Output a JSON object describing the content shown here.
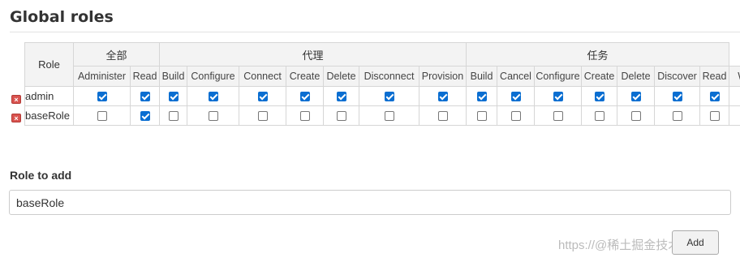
{
  "page": {
    "title": "Global roles"
  },
  "grid": {
    "role_header": "Role",
    "groups": [
      {
        "label": "全部",
        "span": 2
      },
      {
        "label": "代理",
        "span": 7
      },
      {
        "label": "任务",
        "span": 7
      }
    ],
    "permissions": [
      "Administer",
      "Read",
      "Build",
      "Configure",
      "Connect",
      "Create",
      "Delete",
      "Disconnect",
      "Provision",
      "Build",
      "Cancel",
      "Configure",
      "Create",
      "Delete",
      "Discover",
      "Read",
      "Wo"
    ],
    "roles": [
      {
        "name": "admin",
        "checks": [
          true,
          true,
          true,
          true,
          true,
          true,
          true,
          true,
          true,
          true,
          true,
          true,
          true,
          true,
          true,
          true,
          true
        ]
      },
      {
        "name": "baseRole",
        "checks": [
          false,
          true,
          false,
          false,
          false,
          false,
          false,
          false,
          false,
          false,
          false,
          false,
          false,
          false,
          false,
          false,
          false
        ]
      }
    ]
  },
  "add_role": {
    "label": "Role to add",
    "value": "baseRole",
    "button_label": "Add"
  },
  "watermark": "https://@稀土掘金技术社区",
  "colors": {
    "checkbox_checked": "#0a6ed1",
    "delete_icon": "#d9534f"
  }
}
